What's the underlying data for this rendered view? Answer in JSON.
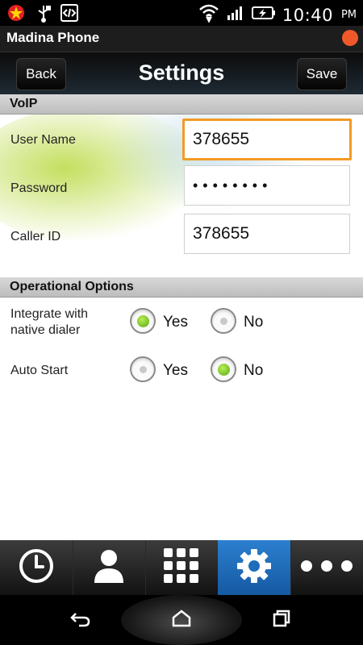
{
  "statusbar": {
    "time": "10:40",
    "ampm": "PM",
    "left_icons": [
      "notification-star-icon",
      "usb-icon",
      "developer-code-icon"
    ],
    "right_icons": [
      "wifi-icon",
      "signal-icon",
      "battery-charging-icon"
    ]
  },
  "app": {
    "title": "Madina Phone",
    "status_color": "#f0582a"
  },
  "header": {
    "back_label": "Back",
    "title": "Settings",
    "save_label": "Save"
  },
  "voip": {
    "section_title": "VoIP",
    "username_label": "User Name",
    "username_value": "378655",
    "password_label": "Password",
    "password_value": "••••••••",
    "callerid_label": "Caller ID",
    "callerid_value": "378655"
  },
  "operational": {
    "section_title": "Operational Options",
    "integrate_label": "Integrate with native dialer",
    "integrate_yes": "Yes",
    "integrate_no": "No",
    "integrate_selected": "Yes",
    "autostart_label": "Auto Start",
    "autostart_yes": "Yes",
    "autostart_no": "No",
    "autostart_selected": "No"
  },
  "bottomnav": {
    "items": [
      "history-clock-icon",
      "contacts-person-icon",
      "dialpad-grid-icon",
      "settings-gear-icon",
      "more-dots-icon"
    ],
    "active": "settings-gear-icon",
    "active_color": "#2c7fcf"
  },
  "systemnav": {
    "items": [
      "back-arrow-icon",
      "home-icon",
      "recent-apps-icon"
    ]
  }
}
